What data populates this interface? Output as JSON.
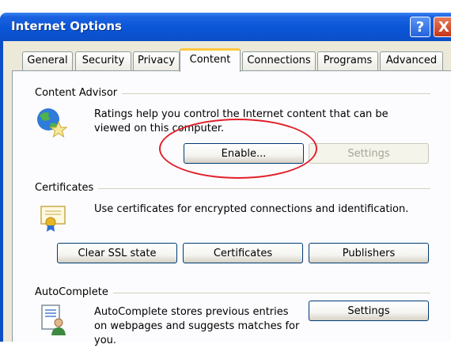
{
  "window": {
    "title": "Internet Options",
    "help_glyph": "?",
    "close_glyph": "X"
  },
  "tabs": [
    {
      "label": "General"
    },
    {
      "label": "Security"
    },
    {
      "label": "Privacy"
    },
    {
      "label": "Content",
      "active": true
    },
    {
      "label": "Connections"
    },
    {
      "label": "Programs"
    },
    {
      "label": "Advanced"
    }
  ],
  "content_advisor": {
    "heading": "Content Advisor",
    "description": "Ratings help you control the Internet content that can be viewed on this computer.",
    "enable_label": "Enable...",
    "settings_label": "Settings",
    "icon": "globe-star-icon"
  },
  "certificates": {
    "heading": "Certificates",
    "description": "Use certificates for encrypted connections and identification.",
    "clear_ssl_label": "Clear SSL state",
    "certificates_label": "Certificates",
    "publishers_label": "Publishers",
    "icon": "certificate-icon"
  },
  "autocomplete": {
    "heading": "AutoComplete",
    "description": "AutoComplete stores previous entries on webpages and suggests matches for you.",
    "settings_label": "Settings",
    "icon": "autocomplete-icon"
  },
  "colors": {
    "title_bar": "#0a55d8",
    "annotation": "#e0202a",
    "active_tab_accent": "#ffc83c",
    "dialog_bg": "#ece9d8"
  }
}
